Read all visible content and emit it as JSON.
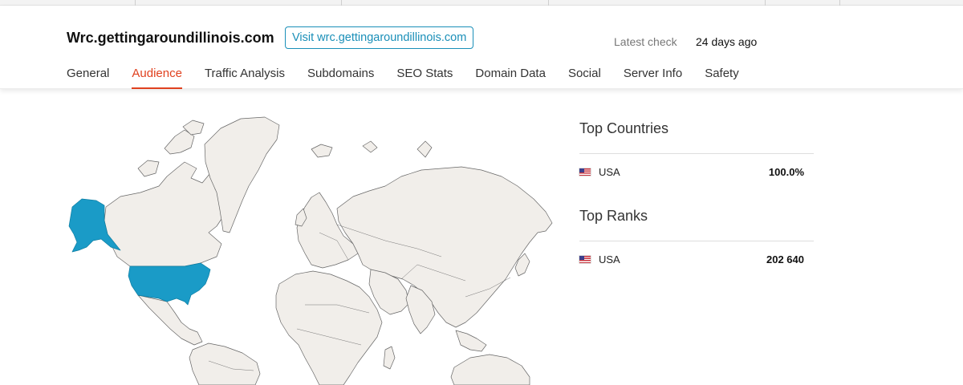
{
  "header": {
    "site_title": "Wrc.gettingaroundillinois.com",
    "visit_button": "Visit wrc.gettingaroundillinois.com",
    "latest_check_label": "Latest check",
    "latest_check_value": "24 days ago"
  },
  "tabs": [
    {
      "label": "General",
      "active": false
    },
    {
      "label": "Audience",
      "active": true
    },
    {
      "label": "Traffic Analysis",
      "active": false
    },
    {
      "label": "Subdomains",
      "active": false
    },
    {
      "label": "SEO Stats",
      "active": false
    },
    {
      "label": "Domain Data",
      "active": false
    },
    {
      "label": "Social",
      "active": false
    },
    {
      "label": "Server Info",
      "active": false
    },
    {
      "label": "Safety",
      "active": false
    }
  ],
  "top_countries": {
    "title": "Top Countries",
    "rows": [
      {
        "country": "USA",
        "value": "100.0%"
      }
    ]
  },
  "top_ranks": {
    "title": "Top Ranks",
    "rows": [
      {
        "country": "USA",
        "value": "202 640"
      }
    ]
  },
  "map": {
    "highlighted_regions": [
      "USA"
    ],
    "highlight_color": "#1a9bc7",
    "land_color": "#f1eeea",
    "border_color": "#666666"
  },
  "colors": {
    "accent_tab": "#e0411f",
    "link": "#1a8fb8"
  }
}
